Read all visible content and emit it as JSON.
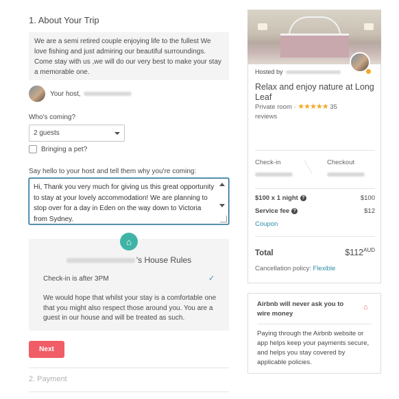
{
  "trip": {
    "section_title": "1. About Your Trip",
    "host_message": "We are a semi retired couple enjoying life to the fullest We love fishing and just admiring our beautiful surroundings. Come stay with us ,we will do our very best to make your stay a memorable one.",
    "your_host_label": "Your host,",
    "whos_coming_label": "Who's coming?",
    "guests_value": "2 guests",
    "pet_label": "Bringing a pet?",
    "say_hello_label": "Say hello to your host and tell them why you're coming:",
    "message_value": "Hi, Thank you very much for giving us this great opportunity to stay at your lovely accommodation! We are planning to stop over for a day in Eden on the way down to Victoria from Sydney.",
    "next_label": "Next",
    "payment_label": "2. Payment"
  },
  "rules": {
    "title_suffix": "'s House Rules",
    "checkin_rule": "Check-in is after 3PM",
    "rules_text": "We would hope that whilst your stay is a comfortable one that you might also respect those around you. You are a guest in our house and will be treated as such."
  },
  "listing": {
    "hosted_by": "Hosted by",
    "title": "Relax and enjoy nature at Long Leaf",
    "room_type": "Private room ·",
    "stars": "★★★★★",
    "reviews_count": "35",
    "reviews_label": "reviews",
    "checkin_label": "Check-in",
    "checkout_label": "Checkout",
    "nightly_label": "$100 x 1 night",
    "nightly_amount": "$100",
    "service_fee_label": "Service fee",
    "service_fee_amount": "$12",
    "coupon_label": "Coupon",
    "total_label": "Total",
    "total_amount": "$112",
    "total_currency": "AUD",
    "cancellation_label": "Cancellation policy:",
    "cancellation_value": "Flexible"
  },
  "notice": {
    "title": "Airbnb will never ask you to wire money",
    "text": "Paying through the Airbnb website or app helps keep your payments secure, and helps you stay covered by applicable policies."
  },
  "colors": {
    "accent": "#f05d66",
    "link": "#2c8ba8",
    "star": "#f5a623",
    "rules_logo": "#3fb4a6"
  }
}
